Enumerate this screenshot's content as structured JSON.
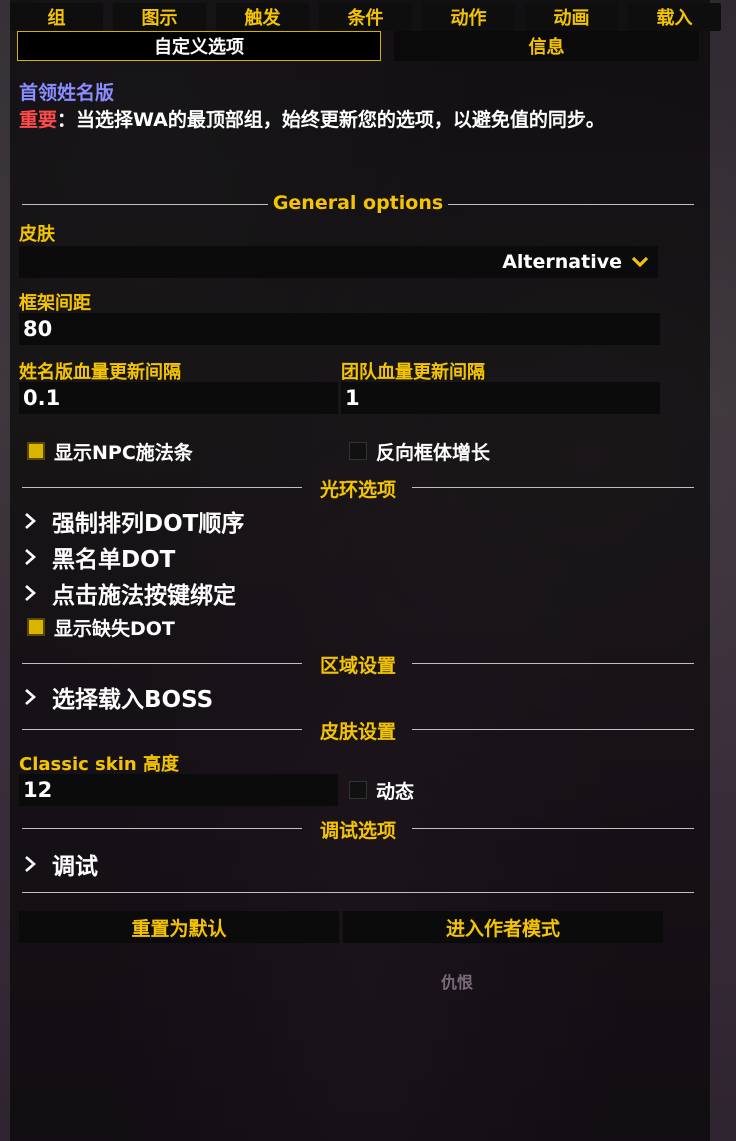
{
  "tabs": [
    "组",
    "图示",
    "触发",
    "条件",
    "动作",
    "动画",
    "载入"
  ],
  "subtabs": {
    "active": "自定义选项",
    "inactive": "信息"
  },
  "header": {
    "title": "首领姓名版",
    "warning_prefix": "重要",
    "warning_text": "：当选择WA的最顶部组，始终更新您的选项，以避免值的同步。"
  },
  "sections": {
    "general": "General options",
    "aura": "光环选项",
    "zone": "区域设置",
    "skin": "皮肤设置",
    "debug": "调试选项"
  },
  "skin": {
    "label": "皮肤",
    "value": "Alternative"
  },
  "frame_spacing": {
    "label": "框架间距",
    "value": "80"
  },
  "nameplate_update": {
    "label": "姓名版血量更新间隔",
    "value": "0.1"
  },
  "raid_update": {
    "label": "团队血量更新间隔",
    "value": "1"
  },
  "checks": {
    "npc_castbar": {
      "label": "显示NPC施法条",
      "checked": true
    },
    "reverse_growth": {
      "label": "反向框体增长",
      "checked": false
    },
    "show_missing_dot": {
      "label": "显示缺失DOT",
      "checked": true
    },
    "dynamic": {
      "label": "动态",
      "checked": false
    }
  },
  "aura_items": [
    "强制排列DOT顺序",
    "黑名单DOT",
    "点击施法按键绑定"
  ],
  "zone_items": [
    "选择载入BOSS"
  ],
  "classic_height": {
    "label": "Classic skin 高度",
    "value": "12"
  },
  "debug_items": [
    "调试"
  ],
  "buttons": {
    "reset": "重置为默认",
    "author": "进入作者模式"
  },
  "footer_note": "仇恨",
  "colors": {
    "accent": "#f5c400",
    "title": "#8a8cff",
    "warning": "#ff4b4b"
  }
}
